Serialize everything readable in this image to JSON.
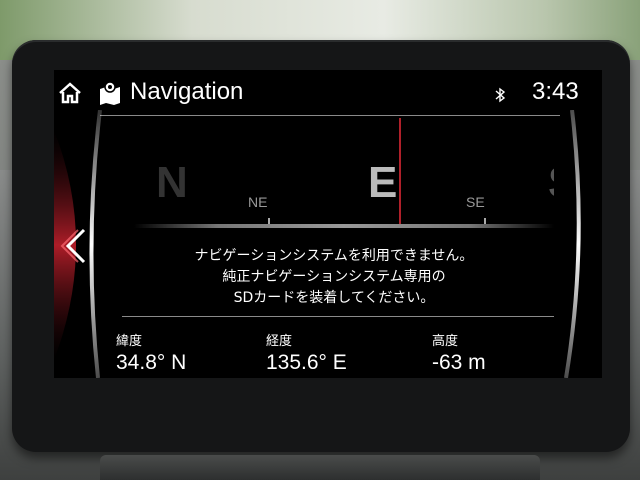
{
  "header": {
    "title": "Navigation",
    "clock": "3:43",
    "icons": {
      "home": "home-icon",
      "navigation": "map-pin-icon",
      "bluetooth": "bluetooth-icon"
    }
  },
  "compass": {
    "cardinals": [
      "N",
      "NE",
      "E",
      "SE",
      "S"
    ],
    "heading": "E"
  },
  "message": {
    "line1": "ナビゲーションシステムを利用できません。",
    "line2": "純正ナビゲーションシステム専用の",
    "line3": "SDカードを装着してください。"
  },
  "coordinates": {
    "latitude": {
      "label": "緯度",
      "value": "34.8° N"
    },
    "longitude": {
      "label": "経度",
      "value": "135.6° E"
    },
    "altitude": {
      "label": "高度",
      "value": "-63 m"
    }
  },
  "controls": {
    "back_icon": "chevron-left-icon"
  },
  "colors": {
    "accent_red": "#c0202c",
    "screen_bg": "#000000",
    "text": "#ffffff"
  }
}
